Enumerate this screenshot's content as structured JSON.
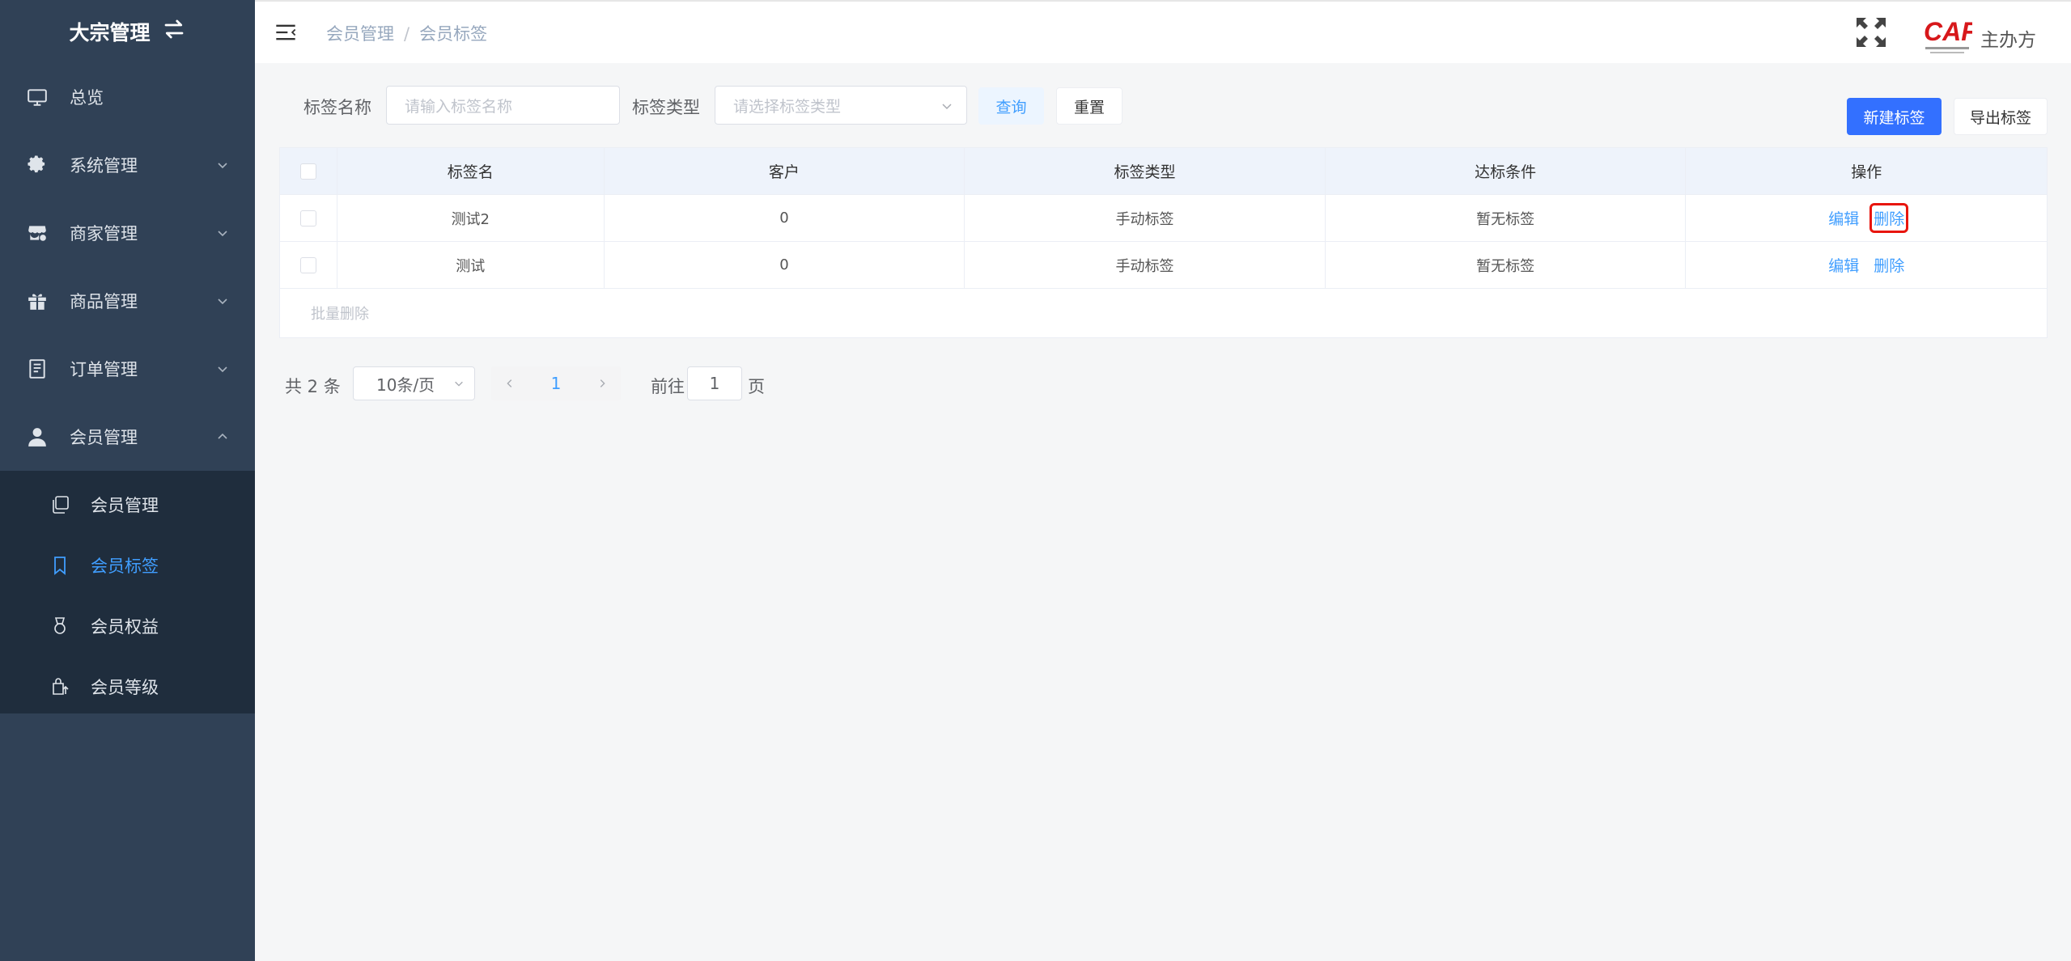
{
  "sidebar": {
    "brand": "大宗管理",
    "items": [
      {
        "label": "总览"
      },
      {
        "label": "系统管理"
      },
      {
        "label": "商家管理"
      },
      {
        "label": "商品管理"
      },
      {
        "label": "订单管理"
      },
      {
        "label": "会员管理"
      }
    ],
    "subitems": [
      {
        "label": "会员管理"
      },
      {
        "label": "会员标签"
      },
      {
        "label": "会员权益"
      },
      {
        "label": "会员等级"
      }
    ]
  },
  "header": {
    "breadcrumb": [
      "会员管理",
      "会员标签"
    ],
    "separator": "/",
    "logo_text": "CAF",
    "organizer": "主办方"
  },
  "search": {
    "name_label": "标签名称",
    "name_placeholder": "请输入标签名称",
    "type_label": "标签类型",
    "type_placeholder": "请选择标签类型",
    "query_button": "查询",
    "reset_button": "重置"
  },
  "actions": {
    "new_tag": "新建标签",
    "export_tag": "导出标签"
  },
  "table": {
    "columns": [
      "标签名",
      "客户",
      "标签类型",
      "达标条件",
      "操作"
    ],
    "rows": [
      {
        "name": "测试2",
        "customers": "0",
        "type": "手动标签",
        "condition": "暂无标签",
        "edit": "编辑",
        "delete": "删除"
      },
      {
        "name": "测试",
        "customers": "0",
        "type": "手动标签",
        "condition": "暂无标签",
        "edit": "编辑",
        "delete": "删除"
      }
    ],
    "batch_delete": "批量删除"
  },
  "pagination": {
    "total": "共 2 条",
    "page_size": "10条/页",
    "current_page": "1",
    "goto_prefix": "前往",
    "goto_value": "1",
    "goto_suffix": "页"
  },
  "colors": {
    "sidebar_bg": "#304156",
    "submenu_bg": "#1f2d3d",
    "accent": "#409eff",
    "primary_button": "#3370ff",
    "highlight_box": "#e8150d"
  }
}
